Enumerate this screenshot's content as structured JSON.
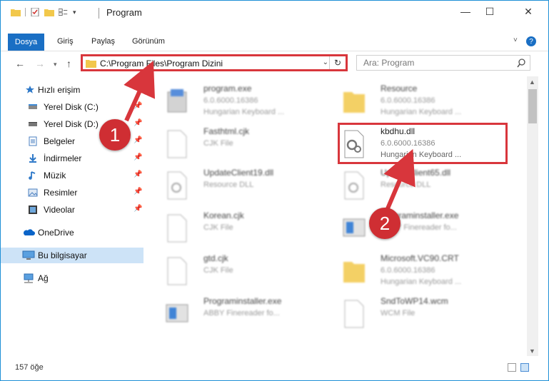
{
  "window": {
    "title": "Program",
    "minimize": "—",
    "maximize": "☐",
    "close": "✕",
    "collapse_ribbon": "˅",
    "help": "?"
  },
  "ribbon": {
    "tabs": [
      "Dosya",
      "Giriş",
      "Paylaş",
      "Görünüm"
    ]
  },
  "address": {
    "path": "C:\\Program Files\\Program Dizini",
    "refresh": "↻"
  },
  "search": {
    "placeholder": "Ara: Program",
    "icon": "search-icon"
  },
  "sidebar": {
    "items": [
      {
        "label": "Hızlı erişim",
        "icon": "star-icon",
        "pinned": false
      },
      {
        "label": "Yerel Disk (C:)",
        "icon": "disk-icon",
        "pinned": true
      },
      {
        "label": "Yerel Disk (D:)",
        "icon": "disk-icon",
        "pinned": true
      },
      {
        "label": "Belgeler",
        "icon": "documents-icon",
        "pinned": true
      },
      {
        "label": "İndirmeler",
        "icon": "download-icon",
        "pinned": true
      },
      {
        "label": "Müzik",
        "icon": "music-icon",
        "pinned": true
      },
      {
        "label": "Resimler",
        "icon": "pictures-icon",
        "pinned": true
      },
      {
        "label": "Videolar",
        "icon": "video-icon",
        "pinned": true
      },
      {
        "label": "OneDrive",
        "icon": "cloud-icon",
        "pinned": false
      },
      {
        "label": "Bu bilgisayar",
        "icon": "computer-icon",
        "pinned": false
      },
      {
        "label": "Ağ",
        "icon": "network-icon",
        "pinned": false
      }
    ]
  },
  "files": [
    {
      "name": "program.exe",
      "line2": "6.0.6000.16386",
      "line3": "Hungarian Keyboard ..."
    },
    {
      "name": "Resource",
      "line2": "6.0.6000.16386",
      "line3": "Hungarian Keyboard ..."
    },
    {
      "name": "Fasthtml.cjk",
      "line2": "CJK File",
      "line3": ""
    },
    {
      "name": "kbdhu.dll",
      "line2": "6.0.6000.16386",
      "line3": "Hungarian Keyboard ..."
    },
    {
      "name": "UpdateClient19.dll",
      "line2": "Resource DLL",
      "line3": ""
    },
    {
      "name": "UpdateClient65.dll",
      "line2": "Resource DLL",
      "line3": ""
    },
    {
      "name": "Korean.cjk",
      "line2": "CJK File",
      "line3": ""
    },
    {
      "name": "Programinstaller.exe",
      "line2": "ABBY Finereader fo...",
      "line3": ""
    },
    {
      "name": "gtd.cjk",
      "line2": "CJK File",
      "line3": ""
    },
    {
      "name": "Microsoft.VC90.CRT",
      "line2": "6.0.6000.16386",
      "line3": "Hungarian Keyboard ..."
    },
    {
      "name": "Programinstaller.exe",
      "line2": "ABBY Finereader fo...",
      "line3": ""
    },
    {
      "name": "SndToWP14.wcm",
      "line2": "WCM File",
      "line3": ""
    }
  ],
  "annotations": {
    "badge1": "1",
    "badge2": "2"
  },
  "status": {
    "count": "157 öğe"
  },
  "colors": {
    "accent": "#1a6fc4",
    "highlight": "#d8363c",
    "selection": "#cde3f7"
  }
}
